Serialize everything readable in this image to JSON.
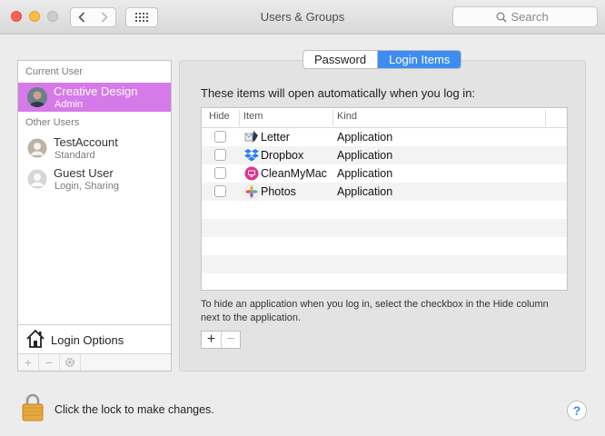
{
  "window": {
    "title": "Users & Groups",
    "search_placeholder": "Search"
  },
  "sidebar": {
    "current_user_label": "Current User",
    "other_users_label": "Other Users",
    "current_user": {
      "name": "Creative Design",
      "role": "Admin"
    },
    "other_users": [
      {
        "name": "TestAccount",
        "role": "Standard"
      },
      {
        "name": "Guest User",
        "role": "Login, Sharing"
      }
    ],
    "login_options_label": "Login Options"
  },
  "tabs": [
    {
      "label": "Password",
      "active": false
    },
    {
      "label": "Login Items",
      "active": true
    }
  ],
  "login_items": {
    "intro": "These items will open automatically when you log in:",
    "columns": {
      "hide": "Hide",
      "item": "Item",
      "kind": "Kind"
    },
    "rows": [
      {
        "name": "Letter",
        "kind": "Application",
        "hidden": false,
        "icon": "letter-app-icon"
      },
      {
        "name": "Dropbox",
        "kind": "Application",
        "hidden": false,
        "icon": "dropbox-icon"
      },
      {
        "name": "CleanMyMac",
        "kind": "Application",
        "hidden": false,
        "icon": "cleanmymac-icon"
      },
      {
        "name": "Photos",
        "kind": "Application",
        "hidden": false,
        "icon": "photos-icon"
      }
    ],
    "help_text": "To hide an application when you log in, select the checkbox in the Hide column next to the application."
  },
  "footer": {
    "lock_text": "Click the lock to make changes.",
    "help_label": "?"
  },
  "colors": {
    "selection": "#d57ae8",
    "accent": "#3d8cf2"
  }
}
